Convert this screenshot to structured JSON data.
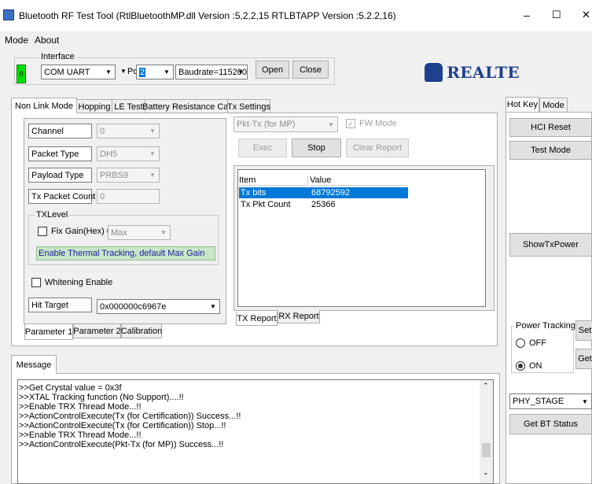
{
  "window": {
    "title": "Bluetooth RF Test Tool (RtlBluetoothMP.dll Version :5,2,2,15   RTLBTAPP Version :5.2.2,16)",
    "minimize": "–",
    "maximize": "☐",
    "close": "✕"
  },
  "menu": [
    "Mode",
    "About"
  ],
  "interface": {
    "title": "Interface",
    "status_led": "0",
    "connection": "COM UART",
    "port_label": "Port",
    "port_value": "2",
    "baudrate": "Baudrate=115200",
    "open_label": "Open",
    "close_label": "Close"
  },
  "brand": {
    "logo_text": "REALTEK",
    "color": "#1f3f8f"
  },
  "tabs": [
    "Non Link Mode",
    "Hopping",
    "LE Test",
    "Battery Resistance Cal",
    "Tx Settings"
  ],
  "params": {
    "channel_label": "Channel",
    "channel_value": "0",
    "packet_type_label": "Packet Type",
    "packet_type_value": "DH5",
    "payload_type_label": "Payload Type",
    "payload_type_value": "PRBS9",
    "tx_count_label": "Tx Packet Count",
    "tx_count_value": "0",
    "txlevel_title": "TXLevel",
    "fix_gain_label": "Fix Gain(Hex)  0x",
    "fix_gain_value": "Max",
    "thermal_text": "Enable Thermal Tracking, default Max Gain",
    "whitening_label": "Whitening Enable",
    "hit_target_label": "Hit Target",
    "hit_target_value": "0x000000c6967e"
  },
  "param_tabs": [
    "Parameter 1",
    "Parameter 2",
    "Calibration"
  ],
  "action": {
    "mode_value": "Pkt-Tx (for MP)",
    "fw_mode_label": "FW Mode",
    "exec_label": "Exec",
    "stop_label": "Stop",
    "clear_label": "Clear Report"
  },
  "report": {
    "columns": [
      "Item",
      "Value"
    ],
    "rows": [
      {
        "item": "Tx bits",
        "value": "68792592"
      },
      {
        "item": "Tx Pkt Count",
        "value": "25366"
      }
    ],
    "tabs": [
      "TX Report",
      "RX Report"
    ]
  },
  "right_panel": {
    "tabs": [
      "Hot Key",
      "Mode"
    ],
    "hci_reset": "HCI Reset",
    "test_mode": "Test Mode",
    "show_tx_power": "ShowTxPower",
    "power_tracking_title": "Power Tracking",
    "off_label": "OFF",
    "on_label": "ON",
    "set_label": "Set",
    "get_label": "Get",
    "stage_value": "PHY_STAGE",
    "get_bt_status": "Get BT Status"
  },
  "message": {
    "tab": "Message",
    "lines": [
      ">>Get Crystal value = 0x3f",
      ">>XTAL Tracking function (No Support)....!!",
      ">>Enable TRX Thread Mode...!!",
      ">>ActionControlExecute(Tx (for Certification)) Success...!!",
      ">>ActionControlExecute(Tx (for Certification)) Stop...!!",
      ">>Enable TRX Thread Mode...!!",
      ">>ActionControlExecute(Pkt-Tx (for MP)) Success...!!"
    ]
  },
  "colors": {
    "selected_row": "#0078d7",
    "led_green": "#00e000",
    "thermal_bg": "#c8e6c8",
    "thermal_text": "#1a1a9c"
  }
}
